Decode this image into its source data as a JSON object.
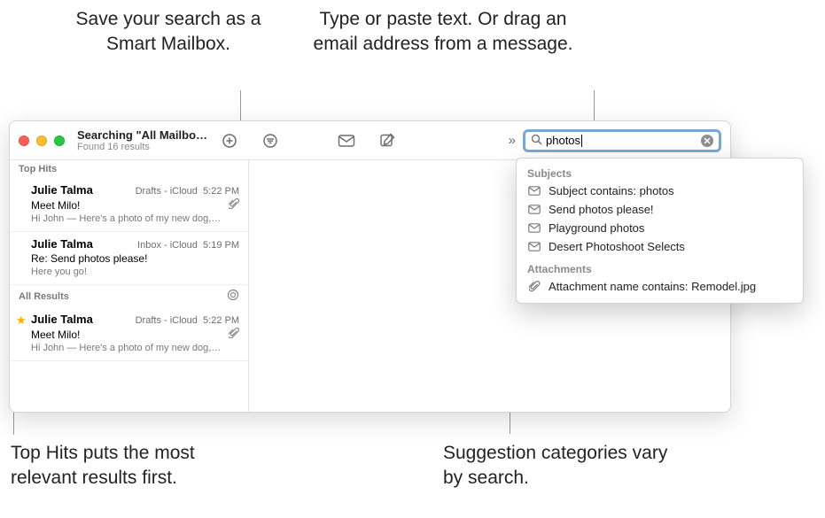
{
  "callouts": {
    "smartMailbox": "Save your search as a Smart Mailbox.",
    "searchField": "Type or paste text. Or drag an email address from a message.",
    "topHits": "Top Hits puts the most relevant results first.",
    "suggestions": "Suggestion categories vary by search."
  },
  "header": {
    "title": "Searching \"All Mailbo…",
    "subtitle": "Found 16 results"
  },
  "search": {
    "value": "photos"
  },
  "listSections": {
    "topHits": "Top Hits",
    "allResults": "All Results"
  },
  "messages_topHits": [
    {
      "sender": "Julie Talma",
      "mailbox": "Drafts - iCloud",
      "time": "5:22 PM",
      "subject": "Meet Milo!",
      "preview": "Hi John — Here's a photo of my new dog,…",
      "hasAttachment": true
    },
    {
      "sender": "Julie Talma",
      "mailbox": "Inbox - iCloud",
      "time": "5:19 PM",
      "subject": "Re: Send photos please!",
      "preview": "Here you go!",
      "hasAttachment": false
    }
  ],
  "messages_allResults": [
    {
      "sender": "Julie Talma",
      "mailbox": "Drafts - iCloud",
      "time": "5:22 PM",
      "subject": "Meet Milo!",
      "preview": "Hi John — Here's a photo of my new dog,…",
      "hasAttachment": true,
      "flagged": true
    }
  ],
  "suggestions": {
    "subjectsHeader": "Subjects",
    "subjectItems": [
      "Subject contains: photos",
      "Send photos please!",
      "Playground photos",
      "Desert Photoshoot Selects"
    ],
    "attachmentsHeader": "Attachments",
    "attachmentItems": [
      "Attachment name contains: Remodel.jpg"
    ]
  }
}
